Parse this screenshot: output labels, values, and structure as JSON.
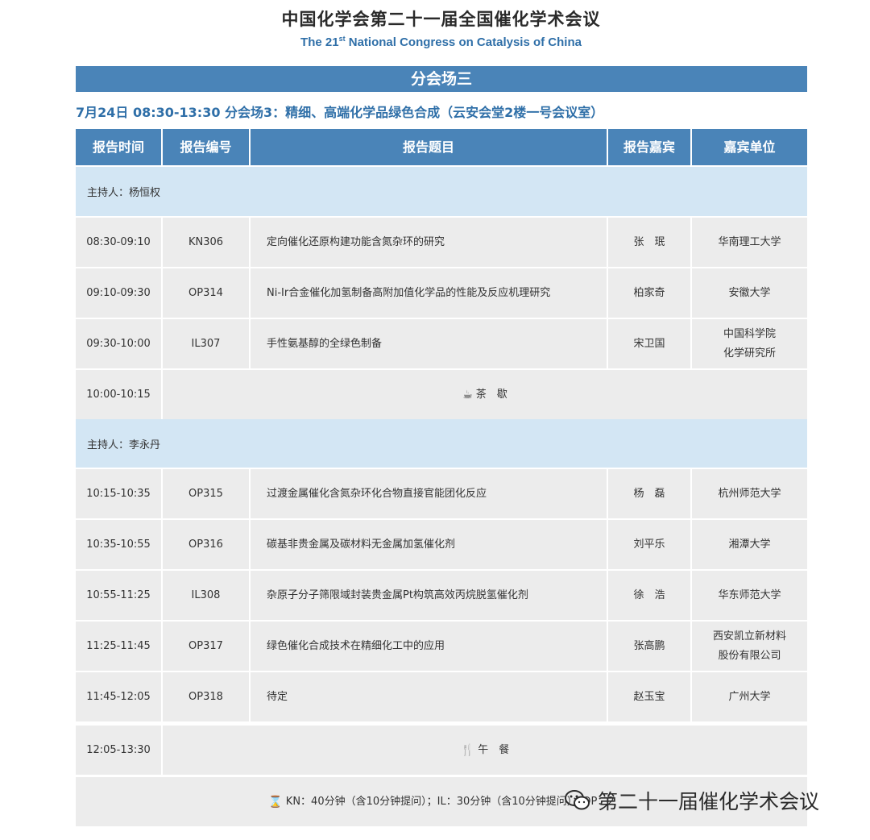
{
  "header": {
    "title_cn": "中国化学会第二十一届全国催化学术会议",
    "title_en_pre": "The 21",
    "title_en_sup": "st",
    "title_en_post": " National Congress on Catalysis of China"
  },
  "session": {
    "name": "分会场三",
    "info": "7月24日  08:30-13:30  分会场3：精细、高端化学品绿色合成（云安会堂2楼一号会议室）"
  },
  "table": {
    "columns": [
      "报告时间",
      "报告编号",
      "报告题目",
      "报告嘉宾",
      "嘉宾单位"
    ],
    "host1": "主持人：杨恒权",
    "host2": "主持人：李永丹",
    "rows": [
      {
        "time": "08:30-09:10",
        "code": "KN306",
        "title": "定向催化还原构建功能含氮杂环的研究",
        "speaker": "张　珉",
        "unit1": "华南理工大学",
        "unit2": ""
      },
      {
        "time": "09:10-09:30",
        "code": "OP314",
        "title": "Ni-Ir合金催化加氢制备高附加值化学品的性能及反应机理研究",
        "speaker": "柏家奇",
        "unit1": "安徽大学",
        "unit2": ""
      },
      {
        "time": "09:30-10:00",
        "code": "IL307",
        "title": "手性氨基醇的全绿色制备",
        "speaker": "宋卫国",
        "unit1": "中国科学院",
        "unit2": "化学研究所"
      },
      {
        "time": "10:15-10:35",
        "code": "OP315",
        "title": "过渡金属催化含氮杂环化合物直接官能团化反应",
        "speaker": "杨　磊",
        "unit1": "杭州师范大学",
        "unit2": ""
      },
      {
        "time": "10:35-10:55",
        "code": "OP316",
        "title": "碳基非贵金属及碳材料无金属加氢催化剂",
        "speaker": "刘平乐",
        "unit1": "湘潭大学",
        "unit2": ""
      },
      {
        "time": "10:55-11:25",
        "code": "IL308",
        "title": "杂原子分子筛限域封装贵金属Pt构筑高效丙烷脱氢催化剂",
        "speaker": "徐　浩",
        "unit1": "华东师范大学",
        "unit2": ""
      },
      {
        "time": "11:25-11:45",
        "code": "OP317",
        "title": "绿色催化合成技术在精细化工中的应用",
        "speaker": "张高鹏",
        "unit1": "西安凯立新材料",
        "unit2": "股份有限公司"
      },
      {
        "time": "11:45-12:05",
        "code": "OP318",
        "title": "待定",
        "speaker": "赵玉宝",
        "unit1": "广州大学",
        "unit2": ""
      }
    ],
    "break_tea": {
      "time": "10:00-10:15",
      "label": "茶　歇",
      "icon": "tea-cup-icon"
    },
    "break_lunch": {
      "time": "12:05-13:30",
      "label": "午　餐",
      "icon": "fork-knife-icon"
    },
    "footnote": "KN：40分钟（含10分钟提问）；IL：30分钟（含10分钟提问）；OP：2",
    "footnote_icon": "hourglass-icon"
  },
  "watermark": {
    "text": "第二十一届催化学术会议",
    "icon": "wechat-icon"
  }
}
